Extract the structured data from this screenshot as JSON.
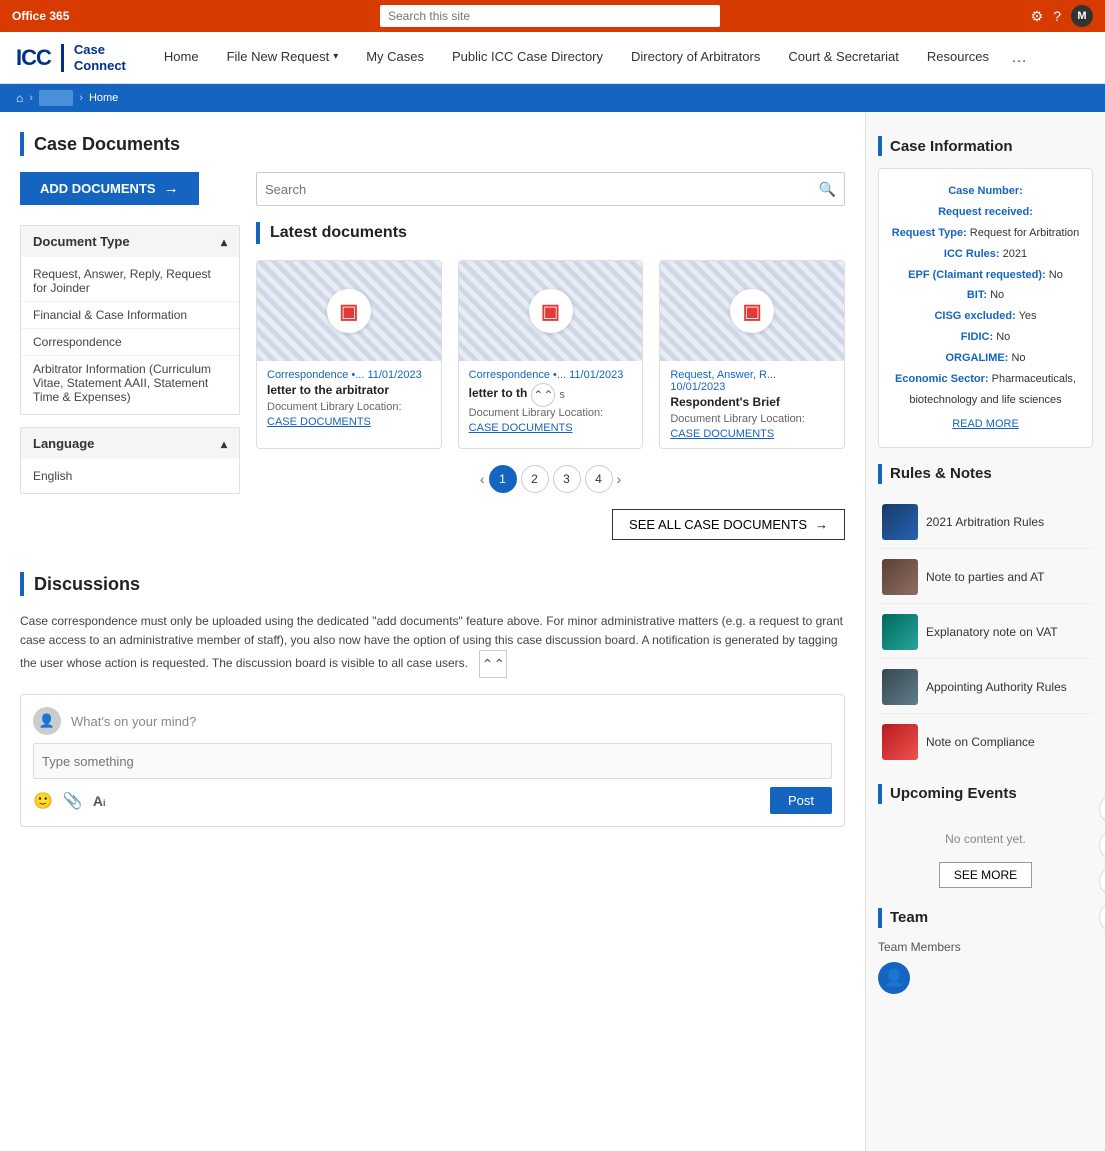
{
  "topbar": {
    "title": "Office 365",
    "search_placeholder": "Search this site",
    "avatar_letter": "M"
  },
  "navbar": {
    "logo_icc": "ICC",
    "logo_cc_line1": "Case",
    "logo_cc_line2": "Connect",
    "links": [
      {
        "label": "Home",
        "has_arrow": false
      },
      {
        "label": "File New Request",
        "has_arrow": true
      },
      {
        "label": "My Cases",
        "has_arrow": false
      },
      {
        "label": "Public ICC Case Directory",
        "has_arrow": false
      },
      {
        "label": "Directory of Arbitrators",
        "has_arrow": false
      },
      {
        "label": "Court & Secretariat",
        "has_arrow": false
      },
      {
        "label": "Resources",
        "has_arrow": false
      }
    ]
  },
  "breadcrumb": {
    "home_label": "",
    "middle_label": "",
    "current": "Home"
  },
  "case_documents": {
    "title": "Case Documents",
    "add_button_label": "ADD DOCUMENTS",
    "search_placeholder": "Search",
    "latest_title": "Latest documents",
    "see_all_label": "SEE ALL CASE DOCUMENTS",
    "filter": {
      "document_type_label": "Document Type",
      "items": [
        "Request, Answer, Reply, Request for Joinder",
        "Financial & Case Information",
        "Correspondence",
        "Arbitrator Information (Curriculum Vitae, Statement AAII, Statement Time & Expenses)"
      ],
      "language_label": "Language",
      "language_items": [
        "English"
      ]
    },
    "documents": [
      {
        "type": "Correspondence •... 11/01/2023",
        "title": "letter to the arbitrator",
        "location_label": "Document Library Location:",
        "location_link": "CASE DOCUMENTS"
      },
      {
        "type": "Correspondence •... 11/01/2023",
        "title": "letter to th",
        "location_label": "Document Library Location:",
        "location_link": "CASE DOCUMENTS"
      },
      {
        "type": "Request, Answer, R... 10/01/2023",
        "title": "Respondent's Brief",
        "location_label": "Document Library Location:",
        "location_link": "CASE DOCUMENTS"
      }
    ],
    "pagination": [
      "1",
      "2",
      "3",
      "4"
    ]
  },
  "discussions": {
    "title": "Discussions",
    "body": "Case correspondence must only be uploaded using the dedicated \"add documents\" feature above. For minor administrative matters (e.g. a request to grant case access to an administrative member of staff), you also now have the option of using this case discussion board. A notification is generated by tagging the user whose action is requested. The discussion board is visible to all case users.",
    "whats_on_mind": "What's on your mind?",
    "type_placeholder": "Type something",
    "post_label": "Post"
  },
  "case_info": {
    "title": "Case Information",
    "read_more": "READ MORE",
    "rows": [
      {
        "label": "Case Number:",
        "value": ""
      },
      {
        "label": "Request received:",
        "value": ""
      },
      {
        "label": "Request Type:",
        "value": "Request for Arbitration"
      },
      {
        "label": "ICC Rules:",
        "value": "2021"
      },
      {
        "label": "EPF (Claimant requested):",
        "value": "No"
      },
      {
        "label": "BIT:",
        "value": "No"
      },
      {
        "label": "CISG excluded:",
        "value": "Yes"
      },
      {
        "label": "FIDIC:",
        "value": "No"
      },
      {
        "label": "ORGALIME:",
        "value": "No"
      },
      {
        "label": "Economic Sector:",
        "value": "Pharmaceuticals, biotechnology and life sciences"
      }
    ]
  },
  "rules_notes": {
    "title": "Rules & Notes",
    "items": [
      {
        "title": "2021 Arbitration Rules",
        "thumb_class": "thumb-blue"
      },
      {
        "title": "Note to parties and AT",
        "thumb_class": "thumb-brown"
      },
      {
        "title": "Explanatory note on VAT",
        "thumb_class": "thumb-teal"
      },
      {
        "title": "Appointing Authority Rules",
        "thumb_class": "thumb-dark"
      },
      {
        "title": "Note on Compliance",
        "thumb_class": "thumb-red"
      }
    ]
  },
  "upcoming_events": {
    "title": "Upcoming Events",
    "no_content": "No content yet.",
    "see_more_label": "SEE MORE"
  },
  "team": {
    "title": "Team",
    "members_label": "Team Members"
  },
  "icons": {
    "search": "🔍",
    "gear": "⚙",
    "help": "?",
    "home": "⌂",
    "chevron_down": "▾",
    "chevron_up": "▴",
    "arrow_right": "→",
    "arrow_left": "←",
    "pdf": "PDF",
    "expand": "⌃",
    "smile": "🙂",
    "attach": "📎",
    "font": "A",
    "person": "👤",
    "star": "☆",
    "eye": "👁",
    "settings": "⚙"
  }
}
